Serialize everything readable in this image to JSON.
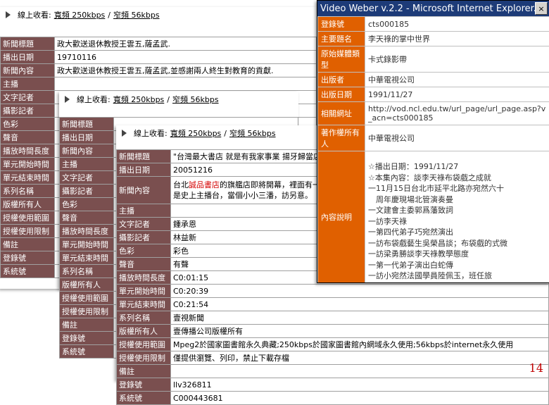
{
  "watchbar": {
    "prefix": "線上收看:",
    "broadband": "寬頻 250kbps",
    "separator": "/",
    "narrowband": "窄頻 56kbps"
  },
  "record1": {
    "rows": [
      {
        "label": "新聞標題",
        "value": "政大歡送退休教授王雲五,薩孟武."
      },
      {
        "label": "播出日期",
        "value": "19710116"
      },
      {
        "label": "新聞內容",
        "value": "政大歡送退休教授王雲五,薩孟武,並感謝兩人終生對教育的貢獻."
      },
      {
        "label": "主播",
        "value": ""
      },
      {
        "label": "文字記者",
        "value": ""
      },
      {
        "label": "攝影記者",
        "value": ""
      },
      {
        "label": "色彩",
        "value": ""
      },
      {
        "label": "聲音",
        "value": ""
      },
      {
        "label": "播放時間長度",
        "value": ""
      },
      {
        "label": "單元開始時間",
        "value": ""
      },
      {
        "label": "單元結束時間",
        "value": ""
      },
      {
        "label": "系列名稱",
        "value": ""
      },
      {
        "label": "版權所有人",
        "value": ""
      },
      {
        "label": "授權使用範圍",
        "value": ""
      },
      {
        "label": "授權使用限制",
        "value": ""
      },
      {
        "label": "備註",
        "value": ""
      },
      {
        "label": "登錄號",
        "value": ""
      },
      {
        "label": "系統號",
        "value": ""
      }
    ]
  },
  "record2": {
    "rows": [
      {
        "label": "新聞標題",
        "value": ""
      },
      {
        "label": "播出日期",
        "value": ""
      },
      {
        "label": "新聞內容",
        "value": ""
      },
      {
        "label": "主播",
        "value": ""
      },
      {
        "label": "文字記者",
        "value": ""
      },
      {
        "label": "攝影記者",
        "value": ""
      },
      {
        "label": "色彩",
        "value": ""
      },
      {
        "label": "聲音",
        "value": ""
      },
      {
        "label": "播放時間長度",
        "value": ""
      },
      {
        "label": "單元開始時間",
        "value": ""
      },
      {
        "label": "單元結束時間",
        "value": ""
      },
      {
        "label": "系列名稱",
        "value": ""
      },
      {
        "label": "版權所有人",
        "value": ""
      },
      {
        "label": "授權使用範圍",
        "value": ""
      },
      {
        "label": "授權使用限制",
        "value": ""
      },
      {
        "label": "備註",
        "value": ""
      },
      {
        "label": "登錄號",
        "value": ""
      },
      {
        "label": "系統號",
        "value": ""
      }
    ]
  },
  "record3": {
    "title": "\"台灣最大書店 就是有我家事業 揚牙歸當店另",
    "date": "20051216",
    "content_pre": "台北",
    "content_highlight": "誠品書店",
    "content_post": "的旗艦店即將開幕，裡面有一成",
    "content_line2": "是史上主播台，當個小小三潘，訪另意。",
    "rows": [
      {
        "label": "主播",
        "value": ""
      },
      {
        "label": "文字記者",
        "value": "鍾承恩"
      },
      {
        "label": "攝影記者",
        "value": "林益新"
      },
      {
        "label": "色彩",
        "value": "彩色"
      },
      {
        "label": "聲音",
        "value": "有聲"
      },
      {
        "label": "播放時間長度",
        "value": "C0:01:15"
      },
      {
        "label": "單元開始時間",
        "value": "C0:20:39"
      },
      {
        "label": "單元結束時間",
        "value": "C0:21:54"
      },
      {
        "label": "系列名稱",
        "value": "壹視新聞"
      },
      {
        "label": "版權所有人",
        "value": "壹傳播公司版權所有"
      },
      {
        "label": "授權使用範圍",
        "value": "Mpeg2於國家圖書館永久典藏;250kbps於國家圖書館內網域永久使用;56kbps於internet永久使用"
      },
      {
        "label": "授權使用限制",
        "value": "僅提供瀏覽、列印，禁止下載存檔"
      },
      {
        "label": "備註",
        "value": ""
      },
      {
        "label": "登錄號",
        "value": "llv326811"
      },
      {
        "label": "系統號",
        "value": "C000443681"
      }
    ],
    "label_title": "新聞標題",
    "label_date": "播出日期",
    "label_content": "新聞內容"
  },
  "ie": {
    "title": "Video Weber v.2.2 - Microsoft Internet Explorer...",
    "close": "×",
    "rows": [
      {
        "label": "登錄號",
        "value": "cts000185"
      },
      {
        "label": "主要題名",
        "value": "李天祿的掌中世界"
      },
      {
        "label": "原始媒體類型",
        "value": "卡式錄影帶"
      },
      {
        "label": "出版者",
        "value": "中華電視公司"
      },
      {
        "label": "出版日期",
        "value": "1991/11/27"
      },
      {
        "label": "相關網址",
        "value": "http://vod.ncl.edu.tw/url_page/url_page.asp?v_acn=cts000185"
      },
      {
        "label": "著作權所有人",
        "value": "中華電視公司"
      }
    ],
    "desc_label": "內容說明",
    "desc_lines": [
      "☆播出日期：1991/11/27",
      "☆本集內容：談李天祿布袋戲之成就",
      "一11月15日台北市延平北路亦宛然六十",
      "　周年慶現場北管演奏曼",
      "一文建會主委郭爲藩致詞",
      "一訪李天祿",
      "一第四代弟子巧宛然演出",
      "一訪布袋戲藝生吳榮昌談；布袋戲的式微",
      "一訪梁勇勝談李天祿教學態度",
      "一第一代弟子演出白蛇傳",
      "一訪小宛然法國學員陸佩玉，班任旅"
    ]
  },
  "page_number": "14"
}
